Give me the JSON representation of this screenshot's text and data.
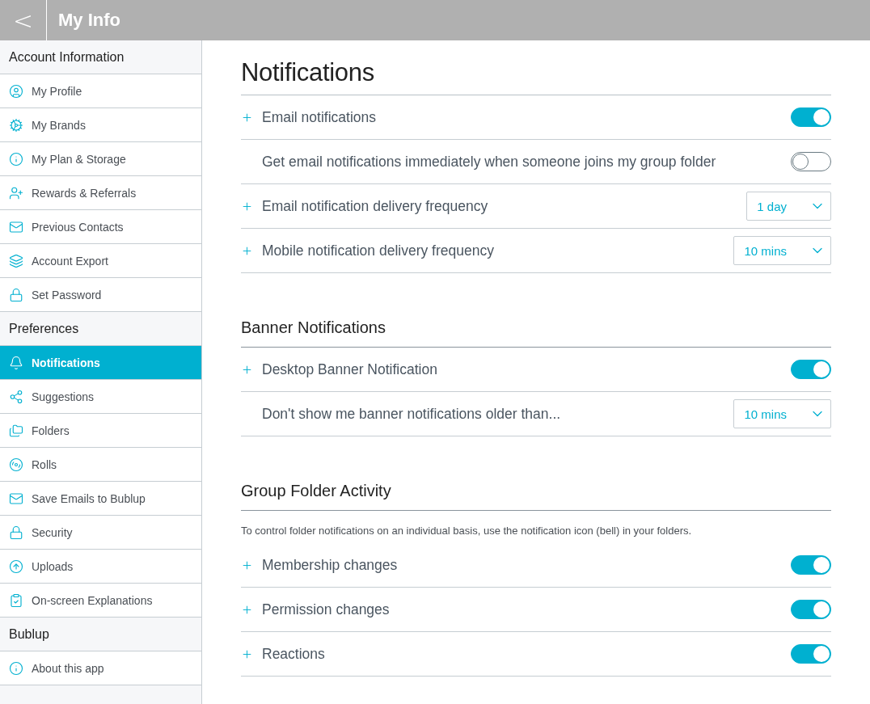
{
  "header": {
    "back": "<",
    "title": "My Info"
  },
  "sidebar": [
    {
      "heading": "Account Information",
      "items": [
        {
          "label": "My Profile",
          "selected": false
        },
        {
          "label": "My Brands",
          "selected": false
        },
        {
          "label": "My Plan & Storage",
          "selected": false
        },
        {
          "label": "Rewards & Referrals",
          "selected": false
        },
        {
          "label": "Previous Contacts",
          "selected": false
        },
        {
          "label": "Account Export",
          "selected": false
        },
        {
          "label": "Set Password",
          "selected": false
        }
      ]
    },
    {
      "heading": "Preferences",
      "items": [
        {
          "label": "Notifications",
          "selected": true
        },
        {
          "label": "Suggestions",
          "selected": false
        },
        {
          "label": "Folders",
          "selected": false
        },
        {
          "label": "Rolls",
          "selected": false
        },
        {
          "label": "Save Emails to Bublup",
          "selected": false
        },
        {
          "label": "Security",
          "selected": false
        },
        {
          "label": "Uploads",
          "selected": false
        },
        {
          "label": "On-screen Explanations",
          "selected": false
        }
      ]
    },
    {
      "heading": "Bublup",
      "items": [
        {
          "label": "About this app",
          "selected": false
        }
      ]
    }
  ],
  "sections": [
    {
      "title": "Notifications",
      "kind": "page",
      "rows": [
        {
          "kind": "toggle",
          "expandable": true,
          "label": "Email notifications",
          "on": true
        },
        {
          "kind": "toggle",
          "expandable": false,
          "label": "Get email notifications immediately when someone joins my group folder",
          "on": false
        },
        {
          "kind": "select",
          "expandable": true,
          "label": "Email notification delivery frequency",
          "value": "1 day"
        },
        {
          "kind": "select",
          "expandable": true,
          "label": "Mobile notification delivery frequency",
          "value": "10 mins"
        }
      ]
    },
    {
      "title": "Banner Notifications",
      "kind": "group",
      "rows": [
        {
          "kind": "toggle",
          "expandable": true,
          "label": "Desktop Banner Notification",
          "on": true
        },
        {
          "kind": "select",
          "expandable": false,
          "label": "Don't show me banner notifications older than...",
          "value": "10 mins"
        }
      ]
    },
    {
      "title": "Group Folder Activity",
      "kind": "group",
      "note": "To control folder notifications on an individual basis, use the notification icon (bell) in your folders.",
      "rows": [
        {
          "kind": "toggle",
          "expandable": true,
          "label": "Membership changes",
          "on": true
        },
        {
          "kind": "toggle",
          "expandable": true,
          "label": "Permission changes",
          "on": true
        },
        {
          "kind": "toggle",
          "expandable": true,
          "label": "Reactions",
          "on": true
        }
      ]
    }
  ]
}
